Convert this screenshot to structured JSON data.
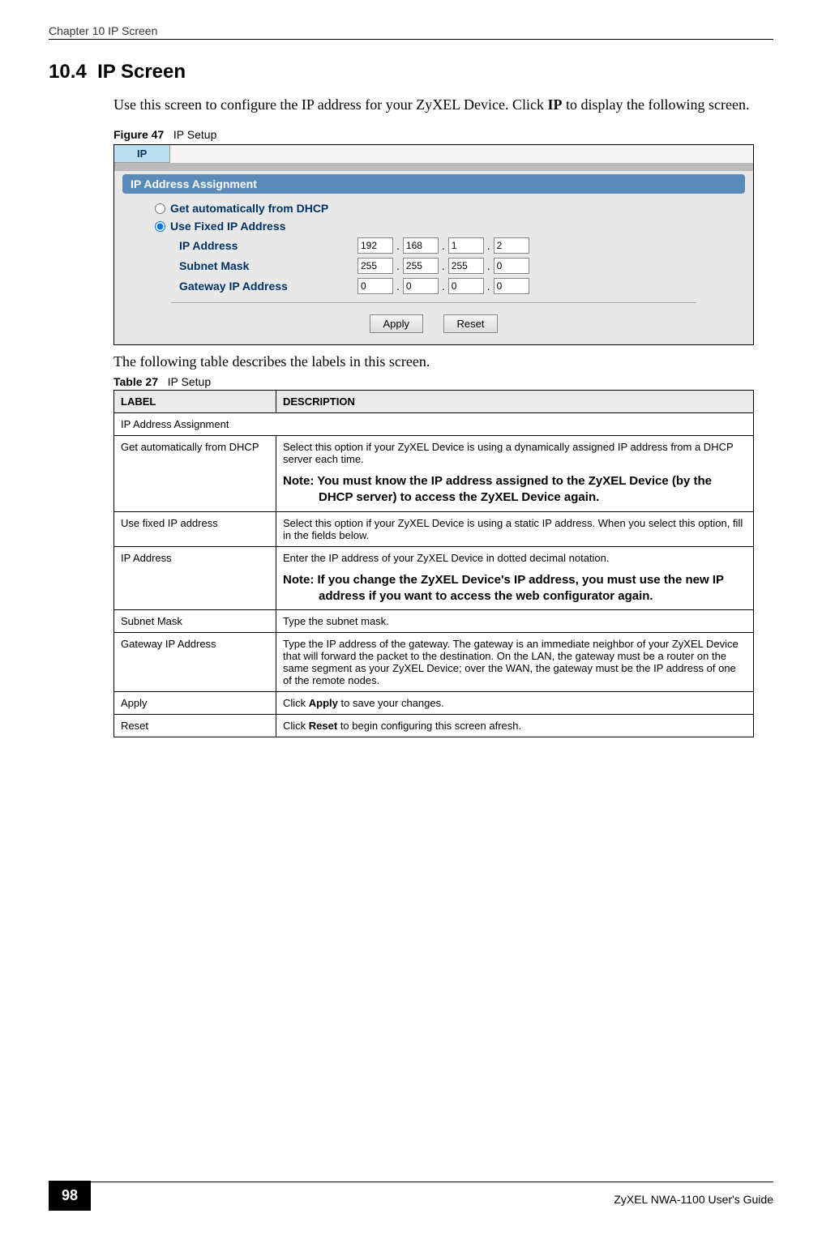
{
  "header": {
    "chapter": "Chapter 10 IP Screen"
  },
  "section": {
    "number": "10.4",
    "title": "IP Screen"
  },
  "intro": {
    "text1": "Use this screen  to configure the IP address for your ZyXEL Device. Click ",
    "bold1": "IP",
    "text2": " to display the following screen."
  },
  "figure": {
    "label": "Figure 47",
    "title": "IP Setup"
  },
  "ui": {
    "tab": "IP",
    "section": "IP Address Assignment",
    "radio_dhcp": "Get automatically from DHCP",
    "radio_fixed": "Use Fixed IP Address",
    "ip_label": "IP Address",
    "subnet_label": "Subnet Mask",
    "gateway_label": "Gateway IP Address",
    "ip": [
      "192",
      "168",
      "1",
      "2"
    ],
    "subnet": [
      "255",
      "255",
      "255",
      "0"
    ],
    "gateway": [
      "0",
      "0",
      "0",
      "0"
    ],
    "apply": "Apply",
    "reset": "Reset"
  },
  "table_intro": "The following table describes the labels in this screen.",
  "table_caption": {
    "label": "Table 27",
    "title": "IP Setup"
  },
  "table": {
    "headers": {
      "label": "LABEL",
      "description": "DESCRIPTION"
    },
    "rows": {
      "r0": {
        "label": "IP Address Assignment",
        "desc": ""
      },
      "r1": {
        "label": "Get automatically from DHCP",
        "desc": "Select this option if your ZyXEL Device is using a dynamically assigned IP address from a DHCP server each time.",
        "note": "Note: You must know the IP address assigned to the ZyXEL Device (by the DHCP server) to access the ZyXEL Device again."
      },
      "r2": {
        "label": "Use fixed IP address",
        "desc": "Select this option if your ZyXEL Device is using a static IP address. When you select this option, fill in the fields below."
      },
      "r3": {
        "label": "IP Address",
        "desc": "Enter the IP address of your ZyXEL Device in dotted decimal notation.",
        "note": "Note: If you change the ZyXEL Device's IP address, you must use the new IP address if you want to access the web configurator again."
      },
      "r4": {
        "label": "Subnet Mask",
        "desc": "Type the subnet mask."
      },
      "r5": {
        "label": "Gateway IP Address",
        "desc": "Type the IP address of the gateway. The gateway is an immediate neighbor of your ZyXEL Device that will forward the packet to the destination. On the LAN, the gateway must be a router on the same segment as your ZyXEL Device; over the WAN, the gateway must be the IP address of one of the remote nodes."
      },
      "r6": {
        "label": "Apply",
        "desc_pre": "Click ",
        "bold": "Apply",
        "desc_post": " to save your changes."
      },
      "r7": {
        "label": "Reset",
        "desc_pre": "Click ",
        "bold": "Reset",
        "desc_post": " to begin configuring this screen afresh."
      }
    }
  },
  "footer": {
    "page": "98",
    "guide": "ZyXEL NWA-1100 User's Guide"
  }
}
